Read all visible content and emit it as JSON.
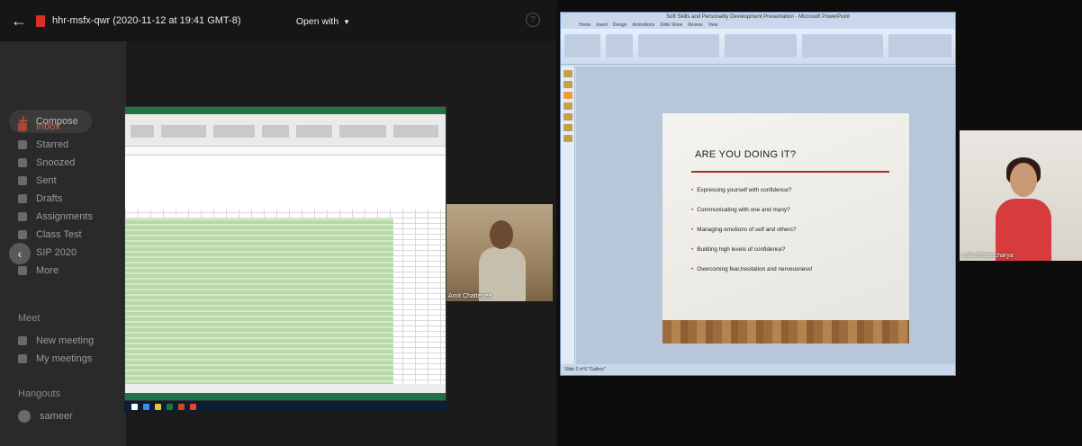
{
  "drive": {
    "file_title": "hhr-msfx-qwr (2020-11-12 at 19:41 GMT-8)",
    "open_with": "Open with",
    "help": "?"
  },
  "gmail": {
    "compose": "Compose",
    "items": [
      "Inbox",
      "Starred",
      "Snoozed",
      "Sent",
      "Drafts",
      "Assignments",
      "Class Test",
      "SIP 2020",
      "More"
    ],
    "meet_header": "Meet",
    "meet_items": [
      "New meeting",
      "My meetings"
    ],
    "hangouts_header": "Hangouts",
    "hangouts_user": "sameer"
  },
  "participants": {
    "left_name": "Amit Chatterjee",
    "right_name": "anita bhattacharya"
  },
  "powerpoint": {
    "window_title": "Soft Skills and Personality Development Presentation - Microsoft PowerPoint",
    "tabs": [
      "Home",
      "Insert",
      "Design",
      "Animations",
      "Slide Show",
      "Review",
      "View"
    ],
    "status": "Slide 2 of 6   \"Gallery\"",
    "slide": {
      "title": "ARE YOU DOING IT?",
      "bullets": [
        "Expressing yourself with confidence?",
        "Communicating with one and many?",
        "Managing emotions of self and others?",
        "Building high levels of confidence?",
        "Overcoming fear,hesitation and nervousness!"
      ]
    }
  },
  "colors": {
    "accent_red": "#d93025",
    "excel_green": "#217346",
    "slide_rule": "#b02a2a"
  }
}
